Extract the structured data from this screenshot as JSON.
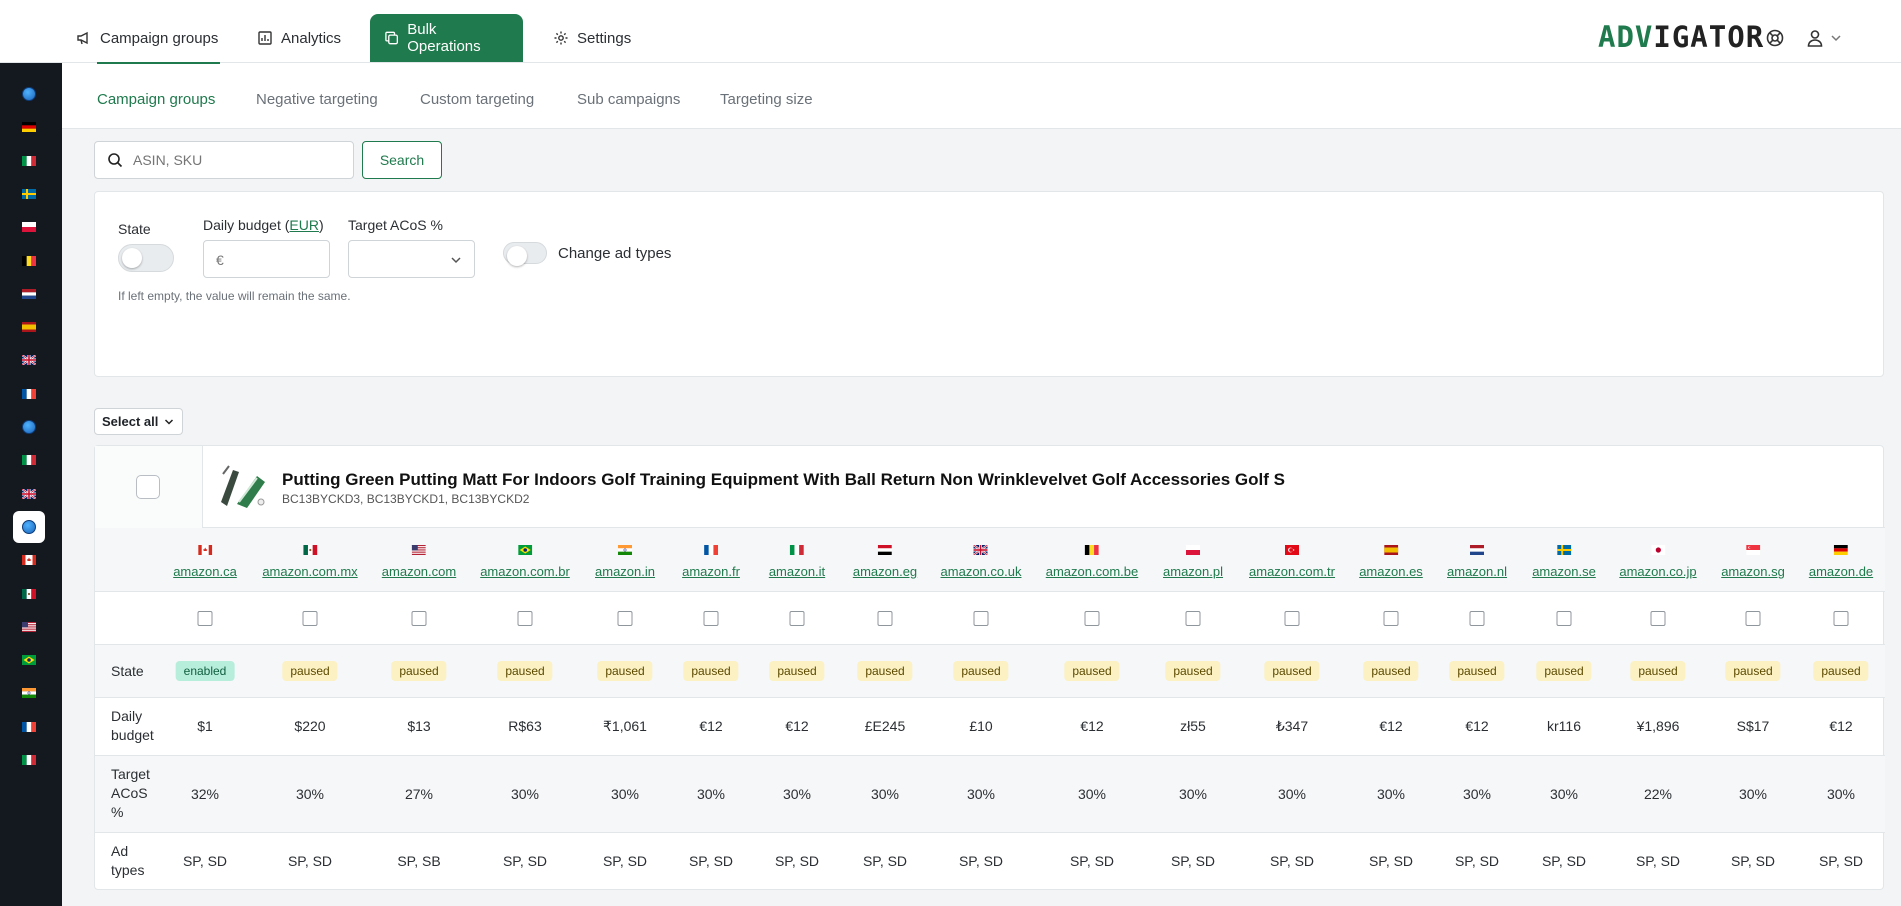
{
  "nav": {
    "items": [
      {
        "label": "Campaign groups",
        "icon": "megaphone-icon",
        "active": false
      },
      {
        "label": "Analytics",
        "icon": "bar-chart-icon",
        "active": false
      },
      {
        "label": "Bulk Operations",
        "icon": "copy-icon",
        "active": true
      },
      {
        "label": "Settings",
        "icon": "gear-icon",
        "active": false
      }
    ],
    "logo": {
      "part1": "ADV",
      "part2": "IGATOR"
    },
    "accent": "#1f7a4d"
  },
  "sidebar": {
    "items": [
      "globe",
      "de",
      "it",
      "se",
      "pl",
      "be",
      "nl",
      "es",
      "uk",
      "fr",
      "globe",
      "it",
      "uk",
      "globe",
      "ca",
      "mx",
      "us",
      "br",
      "in",
      "fr",
      "it"
    ],
    "active_index": 13
  },
  "subtabs": [
    "Campaign groups",
    "Negative targeting",
    "Custom targeting",
    "Sub campaigns",
    "Targeting size"
  ],
  "search": {
    "placeholder": "ASIN, SKU",
    "button": "Search"
  },
  "filters": {
    "state_label": "State",
    "budget_label_prefix": "Daily budget (",
    "budget_currency": "EUR",
    "budget_label_suffix": ")",
    "budget_placeholder": "€",
    "acos_label": "Target ACoS %",
    "ad_types_label": "Change ad types",
    "hint": "If left empty, the value will remain the same."
  },
  "select_all": "Select all",
  "product": {
    "title": "Putting Green Putting Matt For Indoors Golf Training Equipment With Ball Return Non Wrinklevelvet Golf Accessories Golf S",
    "skus": "BC13BYCKD3, BC13BYCKD1, BC13BYCKD2"
  },
  "row_labels": {
    "state": "State",
    "budget_1": "Daily",
    "budget_2": "budget",
    "acos_1": "Target",
    "acos_2": "ACoS",
    "acos_3": "%",
    "ad_1": "Ad",
    "ad_2": "types"
  },
  "marketplaces": [
    {
      "name": "amazon.ca",
      "flag": "ca",
      "state": "enabled",
      "budget": "$1",
      "acos": "32%",
      "ad_types": "SP, SD"
    },
    {
      "name": "amazon.com.mx",
      "flag": "mx",
      "state": "paused",
      "budget": "$220",
      "acos": "30%",
      "ad_types": "SP, SD"
    },
    {
      "name": "amazon.com",
      "flag": "us",
      "state": "paused",
      "budget": "$13",
      "acos": "27%",
      "ad_types": "SP, SB"
    },
    {
      "name": "amazon.com.br",
      "flag": "br",
      "state": "paused",
      "budget": "R$63",
      "acos": "30%",
      "ad_types": "SP, SD"
    },
    {
      "name": "amazon.in",
      "flag": "in",
      "state": "paused",
      "budget": "₹1,061",
      "acos": "30%",
      "ad_types": "SP, SD"
    },
    {
      "name": "amazon.fr",
      "flag": "fr",
      "state": "paused",
      "budget": "€12",
      "acos": "30%",
      "ad_types": "SP, SD"
    },
    {
      "name": "amazon.it",
      "flag": "it",
      "state": "paused",
      "budget": "€12",
      "acos": "30%",
      "ad_types": "SP, SD"
    },
    {
      "name": "amazon.eg",
      "flag": "eg",
      "state": "paused",
      "budget": "£E245",
      "acos": "30%",
      "ad_types": "SP, SD"
    },
    {
      "name": "amazon.co.uk",
      "flag": "uk",
      "state": "paused",
      "budget": "£10",
      "acos": "30%",
      "ad_types": "SP, SD"
    },
    {
      "name": "amazon.com.be",
      "flag": "be",
      "state": "paused",
      "budget": "€12",
      "acos": "30%",
      "ad_types": "SP, SD"
    },
    {
      "name": "amazon.pl",
      "flag": "pl",
      "state": "paused",
      "budget": "zł55",
      "acos": "30%",
      "ad_types": "SP, SD"
    },
    {
      "name": "amazon.com.tr",
      "flag": "tr",
      "state": "paused",
      "budget": "₺347",
      "acos": "30%",
      "ad_types": "SP, SD"
    },
    {
      "name": "amazon.es",
      "flag": "es",
      "state": "paused",
      "budget": "€12",
      "acos": "30%",
      "ad_types": "SP, SD"
    },
    {
      "name": "amazon.nl",
      "flag": "nl",
      "state": "paused",
      "budget": "€12",
      "acos": "30%",
      "ad_types": "SP, SD"
    },
    {
      "name": "amazon.se",
      "flag": "se",
      "state": "paused",
      "budget": "kr116",
      "acos": "30%",
      "ad_types": "SP, SD"
    },
    {
      "name": "amazon.co.jp",
      "flag": "jp",
      "state": "paused",
      "budget": "¥1,896",
      "acos": "22%",
      "ad_types": "SP, SD"
    },
    {
      "name": "amazon.sg",
      "flag": "sg",
      "state": "paused",
      "budget": "S$17",
      "acos": "30%",
      "ad_types": "SP, SD"
    },
    {
      "name": "amazon.de",
      "flag": "de",
      "state": "paused",
      "budget": "€12",
      "acos": "30%",
      "ad_types": "SP, SD"
    }
  ]
}
